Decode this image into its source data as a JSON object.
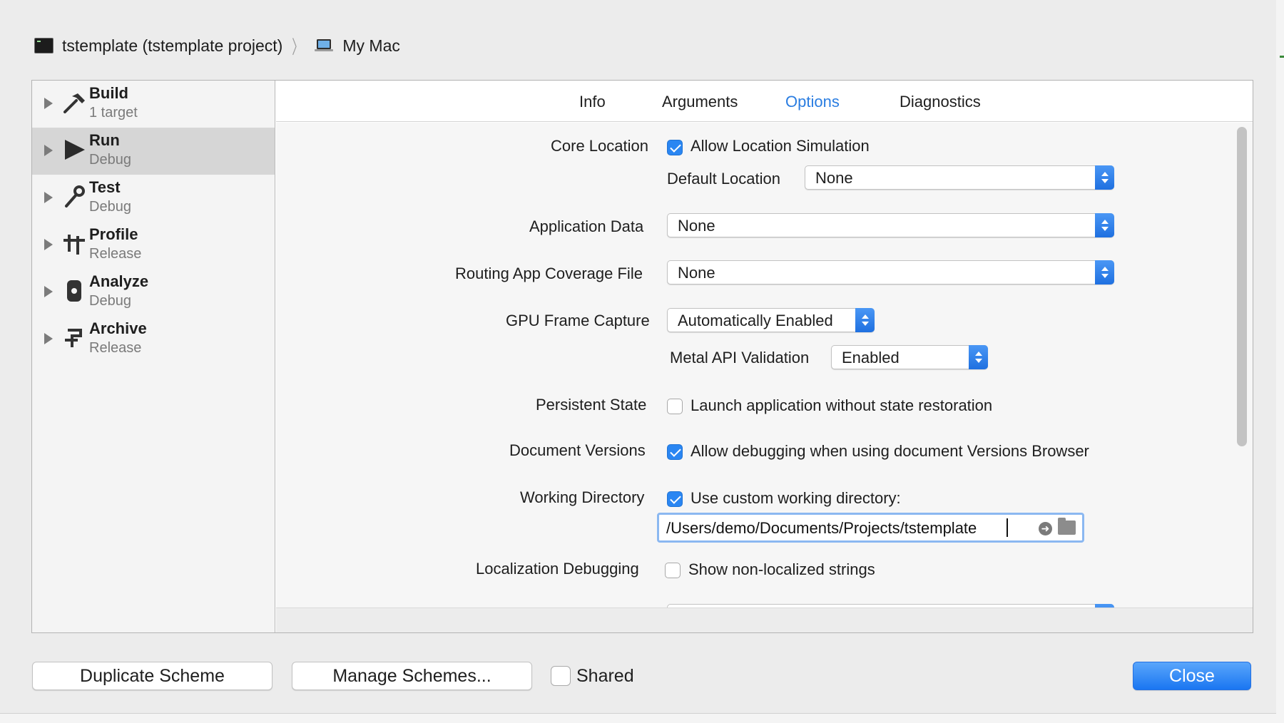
{
  "breadcrumb": {
    "project": "tstemplate (tstemplate project)",
    "destination": "My Mac",
    "project_icon": "terminal-icon",
    "destination_icon": "macbook-icon"
  },
  "sidebar": {
    "items": [
      {
        "title": "Build",
        "subtitle": "1 target",
        "icon": "hammer-icon",
        "selected": false
      },
      {
        "title": "Run",
        "subtitle": "Debug",
        "icon": "play-icon",
        "selected": true
      },
      {
        "title": "Test",
        "subtitle": "Debug",
        "icon": "wrench-icon",
        "selected": false
      },
      {
        "title": "Profile",
        "subtitle": "Release",
        "icon": "instruments-icon",
        "selected": false
      },
      {
        "title": "Analyze",
        "subtitle": "Debug",
        "icon": "analyze-icon",
        "selected": false
      },
      {
        "title": "Archive",
        "subtitle": "Release",
        "icon": "archive-icon",
        "selected": false
      }
    ]
  },
  "tabs": {
    "items": [
      "Info",
      "Arguments",
      "Options",
      "Diagnostics"
    ],
    "active": "Options"
  },
  "options": {
    "core_location": {
      "label": "Core Location",
      "allow_simulation_label": "Allow Location Simulation",
      "allow_simulation_checked": true,
      "default_location_label": "Default Location",
      "default_location_value": "None"
    },
    "application_data": {
      "label": "Application Data",
      "value": "None"
    },
    "routing_file": {
      "label": "Routing App Coverage File",
      "value": "None"
    },
    "gpu_frame_capture": {
      "label": "GPU Frame Capture",
      "value": "Automatically Enabled"
    },
    "metal_api": {
      "label": "Metal API Validation",
      "value": "Enabled"
    },
    "persistent_state": {
      "label": "Persistent State",
      "checkbox_label": "Launch application without state restoration",
      "checked": false
    },
    "document_versions": {
      "label": "Document Versions",
      "checkbox_label": "Allow debugging when using document Versions Browser",
      "checked": true
    },
    "working_directory": {
      "label": "Working Directory",
      "checkbox_label": "Use custom working directory:",
      "checked": true,
      "path": "/Users/demo/Documents/Projects/tstemplate"
    },
    "localization": {
      "label": "Localization Debugging",
      "checkbox_label": "Show non-localized strings",
      "checked": false
    }
  },
  "footer": {
    "duplicate_label": "Duplicate Scheme",
    "manage_label": "Manage Schemes...",
    "shared_label": "Shared",
    "shared_checked": false,
    "close_label": "Close"
  },
  "colors": {
    "accent": "#2a7de1",
    "primary_button": "#1a76f1",
    "sidebar_selected": "#d6d6d6"
  }
}
